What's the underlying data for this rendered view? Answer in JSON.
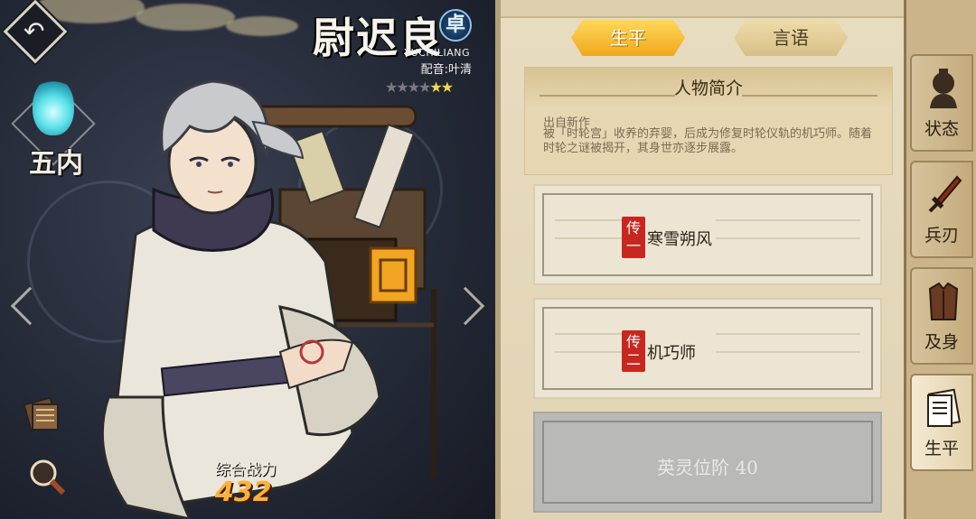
{
  "character": {
    "name": "尉迟良",
    "rank_badge": "卓",
    "romaji": "YUCHILIANG",
    "voice_actor": "配音:叶清",
    "stars_filled": 2,
    "stars_total": 6,
    "element": "五内",
    "combat_power_label": "综合战力",
    "combat_power": "432"
  },
  "tabs": {
    "active": "生平",
    "inactive": "言语"
  },
  "bio": {
    "title": "人物简介",
    "origin": "出自新作",
    "description": "被「时轮宫」收养的弃婴，后成为修复时轮仪轨的机巧师。随着时轮之谜被揭开，其身世亦逐步展露。"
  },
  "story_cards": [
    {
      "seal": "传一",
      "title": "寒雪朔风"
    },
    {
      "seal": "传二",
      "title": "机巧师"
    }
  ],
  "locked_card": {
    "text": "英灵位阶 40"
  },
  "side_nav": [
    {
      "label": "状态",
      "icon": "status-portrait-icon"
    },
    {
      "label": "兵刃",
      "icon": "sword-icon"
    },
    {
      "label": "及身",
      "icon": "armor-icon"
    },
    {
      "label": "生平",
      "icon": "scroll-book-icon"
    }
  ],
  "colors": {
    "tab_active": "#f0a81c",
    "seal_red": "#c7271f",
    "power_orange": "#f7b23a",
    "parchment": "#e8dcc0"
  }
}
